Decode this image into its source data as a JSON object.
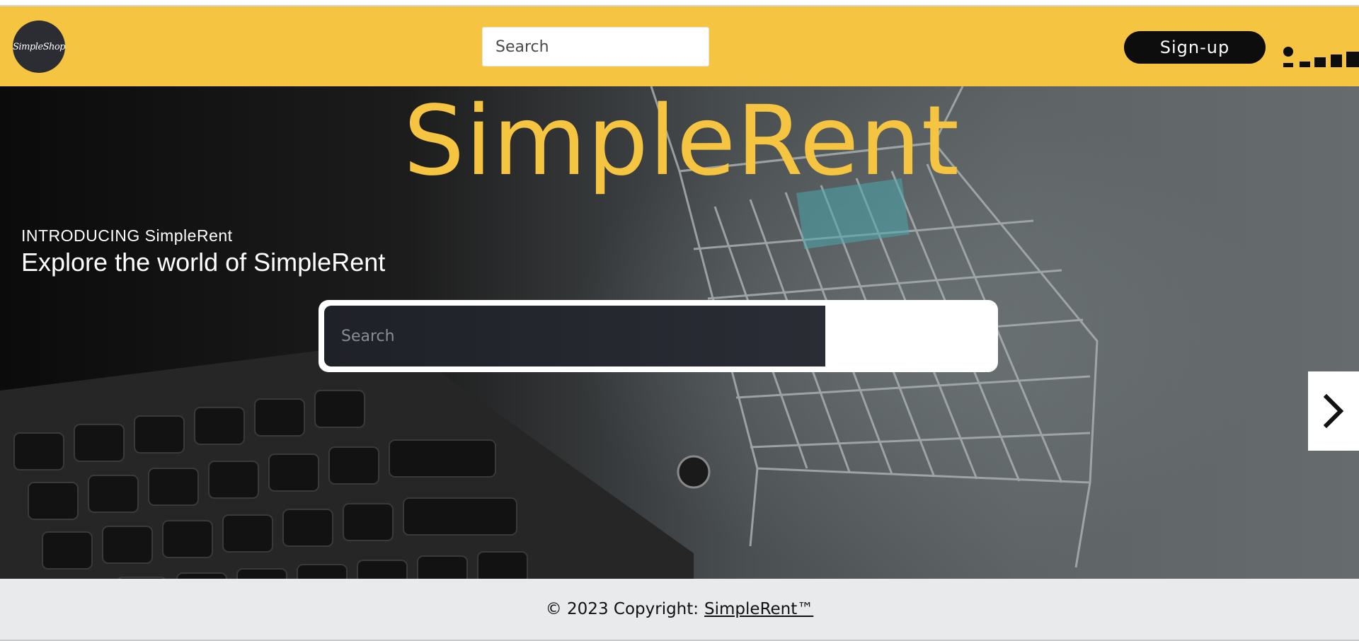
{
  "header": {
    "logo_text": "SimpleShop",
    "search_placeholder": "Search",
    "signup_label": "Sign-up",
    "menu_icon": "menu-icon",
    "background_color": "#f5c440"
  },
  "hero": {
    "title": "SimpleRent",
    "intro": "INTRODUCING SimpleRent",
    "subtitle": "Explore the world of SimpleRent",
    "search_placeholder": "Search",
    "next_icon": "chevron-right-icon",
    "title_color": "#f5c440"
  },
  "footer": {
    "copyright": "© 2023 Copyright:",
    "brand_link": "SimpleRent™"
  }
}
